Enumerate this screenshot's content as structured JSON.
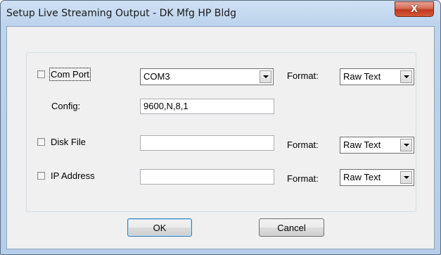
{
  "window": {
    "title": "Setup Live Streaming Output - DK Mfg HP Bldg",
    "close_glyph": "X"
  },
  "com_port": {
    "checkbox_label": "Com Port",
    "checked": false,
    "port_value": "COM3",
    "format_label": "Format:",
    "format_value": "Raw Text",
    "config_label": "Config:",
    "config_value": "9600,N,8,1"
  },
  "disk_file": {
    "checkbox_label": "Disk File",
    "checked": false,
    "path_value": "",
    "format_label": "Format:",
    "format_value": "Raw Text"
  },
  "ip_address": {
    "checkbox_label": "IP Address",
    "checked": false,
    "address_value": "",
    "format_label": "Format:",
    "format_value": "Raw Text"
  },
  "buttons": {
    "ok_label": "OK",
    "cancel_label": "Cancel"
  }
}
